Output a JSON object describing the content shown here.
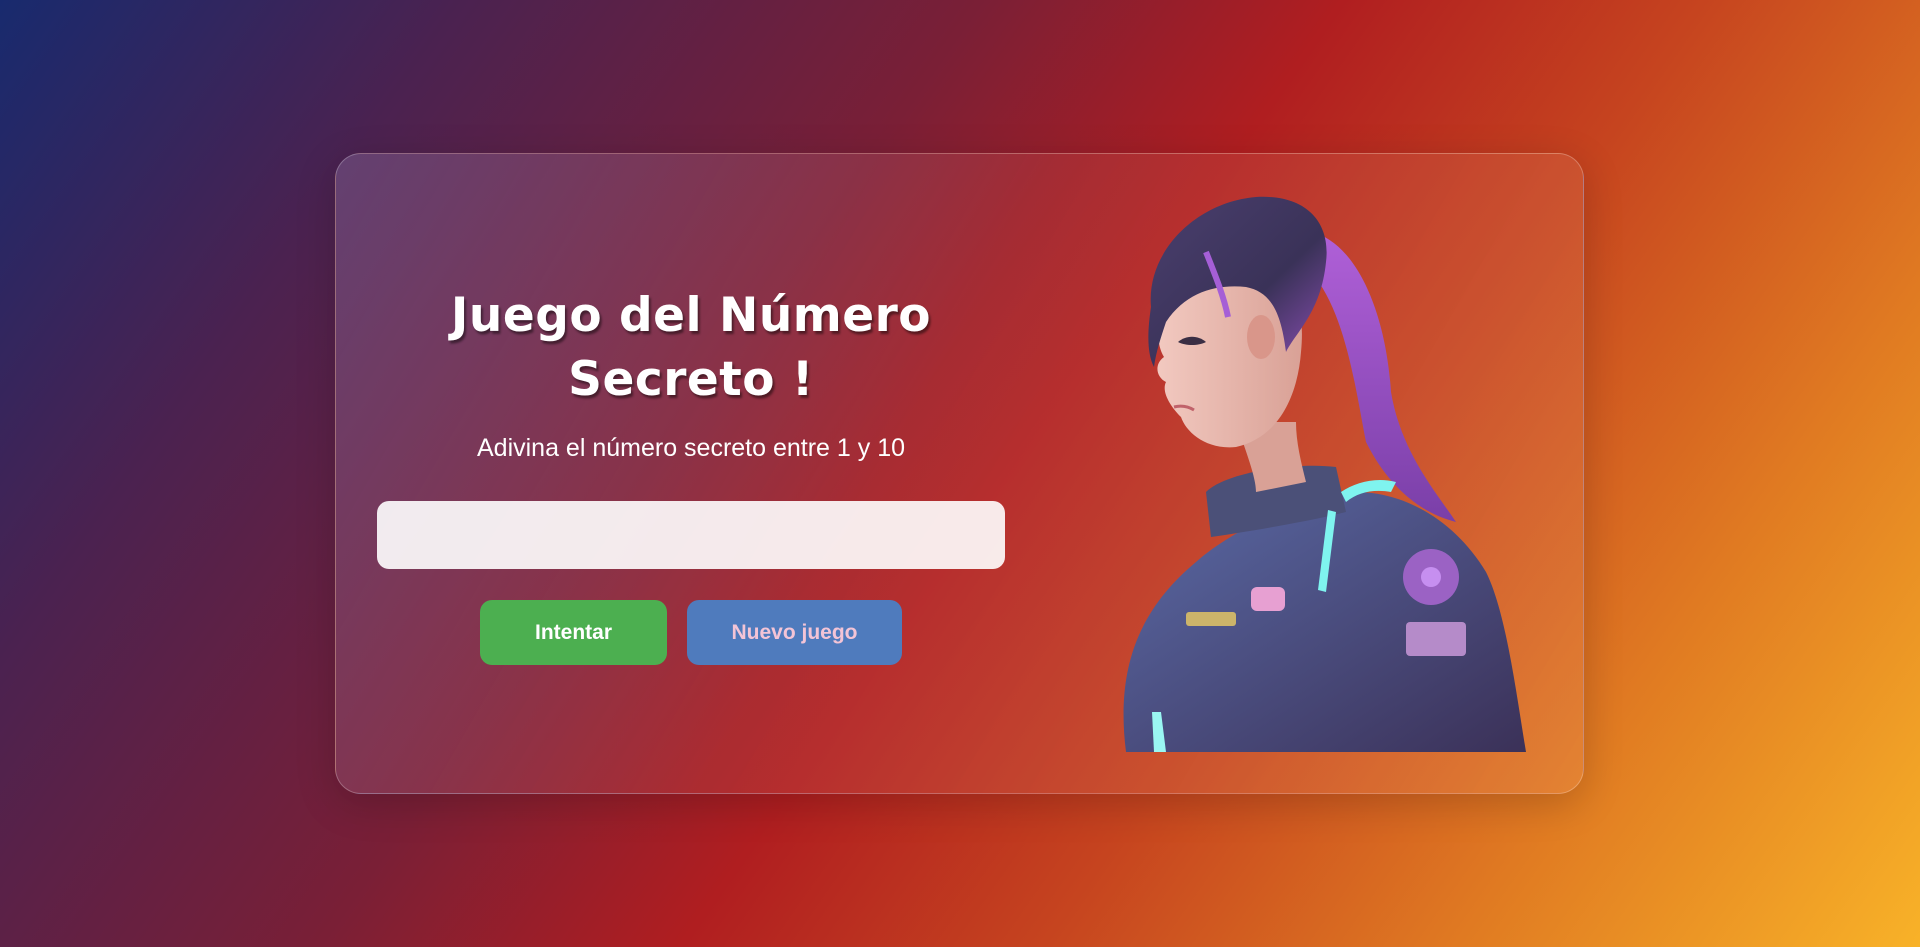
{
  "game": {
    "title_line1": "Juego del Número",
    "title_line2": "Secreto !",
    "instructions": "Adivina el número secreto entre 1 y 10",
    "input_value": "",
    "try_button_label": "Intentar",
    "new_game_button_label": "Nuevo juego"
  },
  "image": {
    "icon": "astronaut-girl-illustration"
  },
  "colors": {
    "try_button": "#4caf50",
    "new_game_button": "#4f7bbd",
    "new_game_label": "#f3c4d6"
  }
}
